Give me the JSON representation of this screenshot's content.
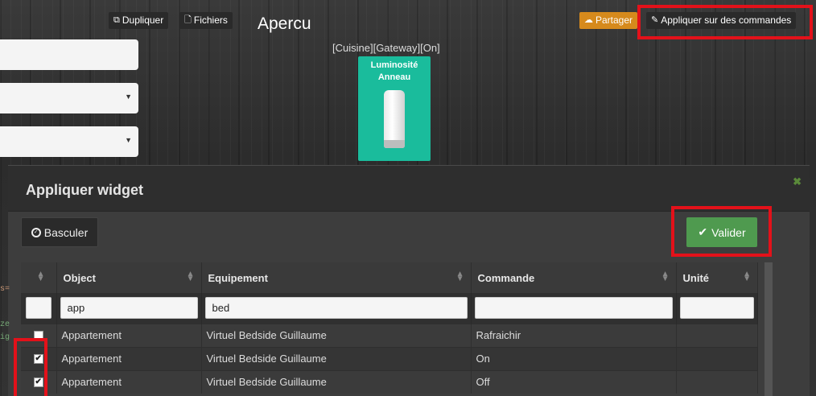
{
  "toolbar": {
    "duplicate_label": "Dupliquer",
    "files_label": "Fichiers",
    "share_label": "Partager",
    "apply_label": "Appliquer sur des commandes"
  },
  "preview": {
    "title": "Apercu",
    "path": "[Cuisine][Gateway][On]",
    "widget_line1": "Luminosité",
    "widget_line2": "Anneau",
    "widget_color": "#1abc9c"
  },
  "modal": {
    "title": "Appliquer widget",
    "toggle_label": "Basculer",
    "validate_label": "Valider"
  },
  "table": {
    "headers": [
      "Object",
      "Equipement",
      "Commande",
      "Unité"
    ],
    "filters": [
      "app",
      "bed",
      "",
      ""
    ],
    "rows": [
      {
        "checked": false,
        "object": "Appartement",
        "equipment": "Virtuel Bedside Guillaume",
        "command": "Rafraichir",
        "unit": ""
      },
      {
        "checked": true,
        "object": "Appartement",
        "equipment": "Virtuel Bedside Guillaume",
        "command": "On",
        "unit": ""
      },
      {
        "checked": true,
        "object": "Appartement",
        "equipment": "Virtuel Bedside Guillaume",
        "command": "Off",
        "unit": ""
      }
    ]
  },
  "colors": {
    "highlight": "#e3111a",
    "share_button": "#d68a1c",
    "validate_button": "#4f9a4f"
  }
}
